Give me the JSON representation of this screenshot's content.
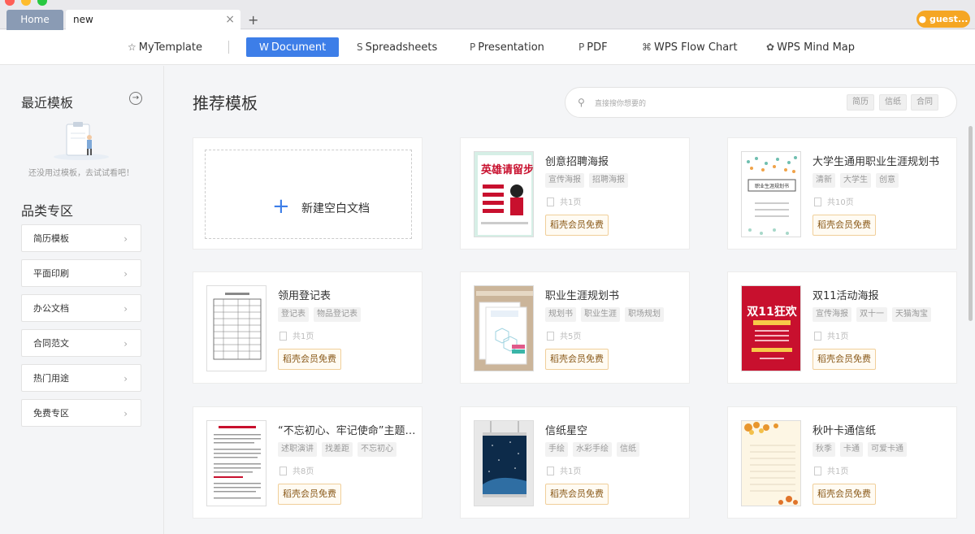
{
  "tabs": {
    "home": "Home",
    "current": "new",
    "close": "×",
    "add": "+"
  },
  "guest": "guest...",
  "nav": [
    {
      "icon": "☆",
      "label": "MyTemplate"
    },
    {
      "icon": "W",
      "label": "Document"
    },
    {
      "icon": "S",
      "label": "Spreadsheets"
    },
    {
      "icon": "P",
      "label": "Presentation"
    },
    {
      "icon": "P",
      "label": "PDF"
    },
    {
      "icon": "⌘",
      "label": "WPS Flow Chart"
    },
    {
      "icon": "✿",
      "label": "WPS Mind Map"
    }
  ],
  "sidebar": {
    "recent_title": "最近模板",
    "recent_arrow": "→",
    "recent_empty": "还没用过模板，去试试看吧！",
    "category_title": "品类专区",
    "categories": [
      "简历模板",
      "平面印刷",
      "办公文档",
      "合同范文",
      "热门用途",
      "免费专区"
    ],
    "chevron": "›"
  },
  "main": {
    "title": "推荐模板",
    "search": {
      "placeholder": "直接搜你想要的",
      "quick_tags": [
        "简历",
        "信纸",
        "合同"
      ]
    },
    "blank": {
      "plus": "+",
      "label": "新建空白文档"
    },
    "templates": [
      {
        "title": "创意招聘海报",
        "tags": [
          "宣传海报",
          "招聘海报"
        ],
        "pages": "共1页",
        "badge": "稻壳会员免费"
      },
      {
        "title": "大学生通用职业生涯规划书",
        "tags": [
          "清新",
          "大学生",
          "创意"
        ],
        "pages": "共10页",
        "badge": "稻壳会员免费"
      },
      {
        "title": "领用登记表",
        "tags": [
          "登记表",
          "物品登记表"
        ],
        "pages": "共1页",
        "badge": "稻壳会员免费"
      },
      {
        "title": "职业生涯规划书",
        "tags": [
          "规划书",
          "职业生涯",
          "职场规划"
        ],
        "pages": "共5页",
        "badge": "稻壳会员免费"
      },
      {
        "title": "双11活动海报",
        "tags": [
          "宣传海报",
          "双十一",
          "天猫淘宝"
        ],
        "pages": "共1页",
        "badge": "稻壳会员免费"
      },
      {
        "title": "“不忘初心、牢记使命”主题…",
        "tags": [
          "述职演讲",
          "找差距",
          "不忘初心"
        ],
        "pages": "共8页",
        "badge": "稻壳会员免费"
      },
      {
        "title": "信纸星空",
        "tags": [
          "手绘",
          "水彩手绘",
          "信纸"
        ],
        "pages": "共1页",
        "badge": "稻壳会员免费"
      },
      {
        "title": "秋叶卡通信纸",
        "tags": [
          "秋季",
          "卡通",
          "可爱卡通"
        ],
        "pages": "共1页",
        "badge": "稻壳会员免费"
      }
    ]
  },
  "thumb_text": {
    "recruit": "英雄请留步",
    "career": "职业生涯规划书",
    "shuang11": "双11狂欢"
  },
  "colors": {
    "accent": "#3d7ee8",
    "guest": "#f5a623",
    "vip_border": "#f0cf9a"
  }
}
